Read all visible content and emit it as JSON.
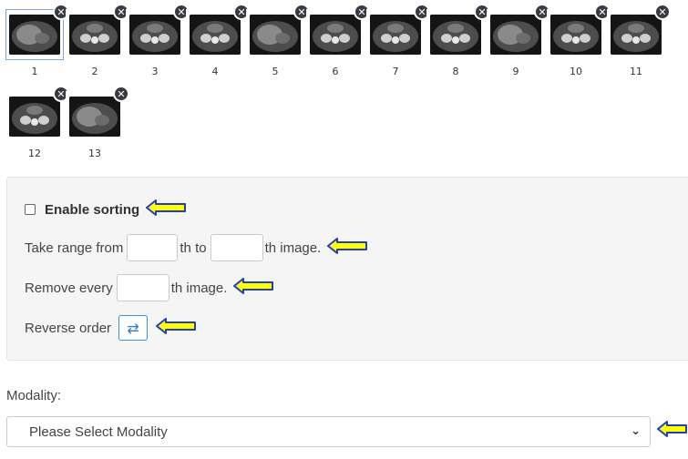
{
  "thumbnails": [
    {
      "label": "1",
      "selected": true
    },
    {
      "label": "2",
      "selected": false
    },
    {
      "label": "3",
      "selected": false
    },
    {
      "label": "4",
      "selected": false
    },
    {
      "label": "5",
      "selected": false
    },
    {
      "label": "6",
      "selected": false
    },
    {
      "label": "7",
      "selected": false
    },
    {
      "label": "8",
      "selected": false
    },
    {
      "label": "9",
      "selected": false
    },
    {
      "label": "10",
      "selected": false
    },
    {
      "label": "11",
      "selected": false
    },
    {
      "label": "12",
      "selected": false
    },
    {
      "label": "13",
      "selected": false
    }
  ],
  "icons": {
    "remove": "close-icon",
    "reverse": "swap-arrows-icon",
    "callout": "yellow-arrow-left-icon",
    "select": "chevron-down-icon"
  },
  "sorting": {
    "enable_label": "Enable sorting",
    "enabled": false,
    "range_prefix": "Take range from",
    "range_mid": "th to",
    "range_suffix": "th image.",
    "range_from_value": "",
    "range_to_value": "",
    "remove_prefix": "Remove every",
    "remove_suffix": "th image.",
    "remove_value": "",
    "reverse_label": "Reverse order",
    "reverse_glyph": "⇄"
  },
  "modality": {
    "label": "Modality:",
    "selected": "Please Select Modality",
    "chevron": "⌄"
  },
  "colors": {
    "callout_fill": "#ffff00",
    "callout_stroke": "#1f3fbf",
    "accent": "#3b8fd6"
  }
}
